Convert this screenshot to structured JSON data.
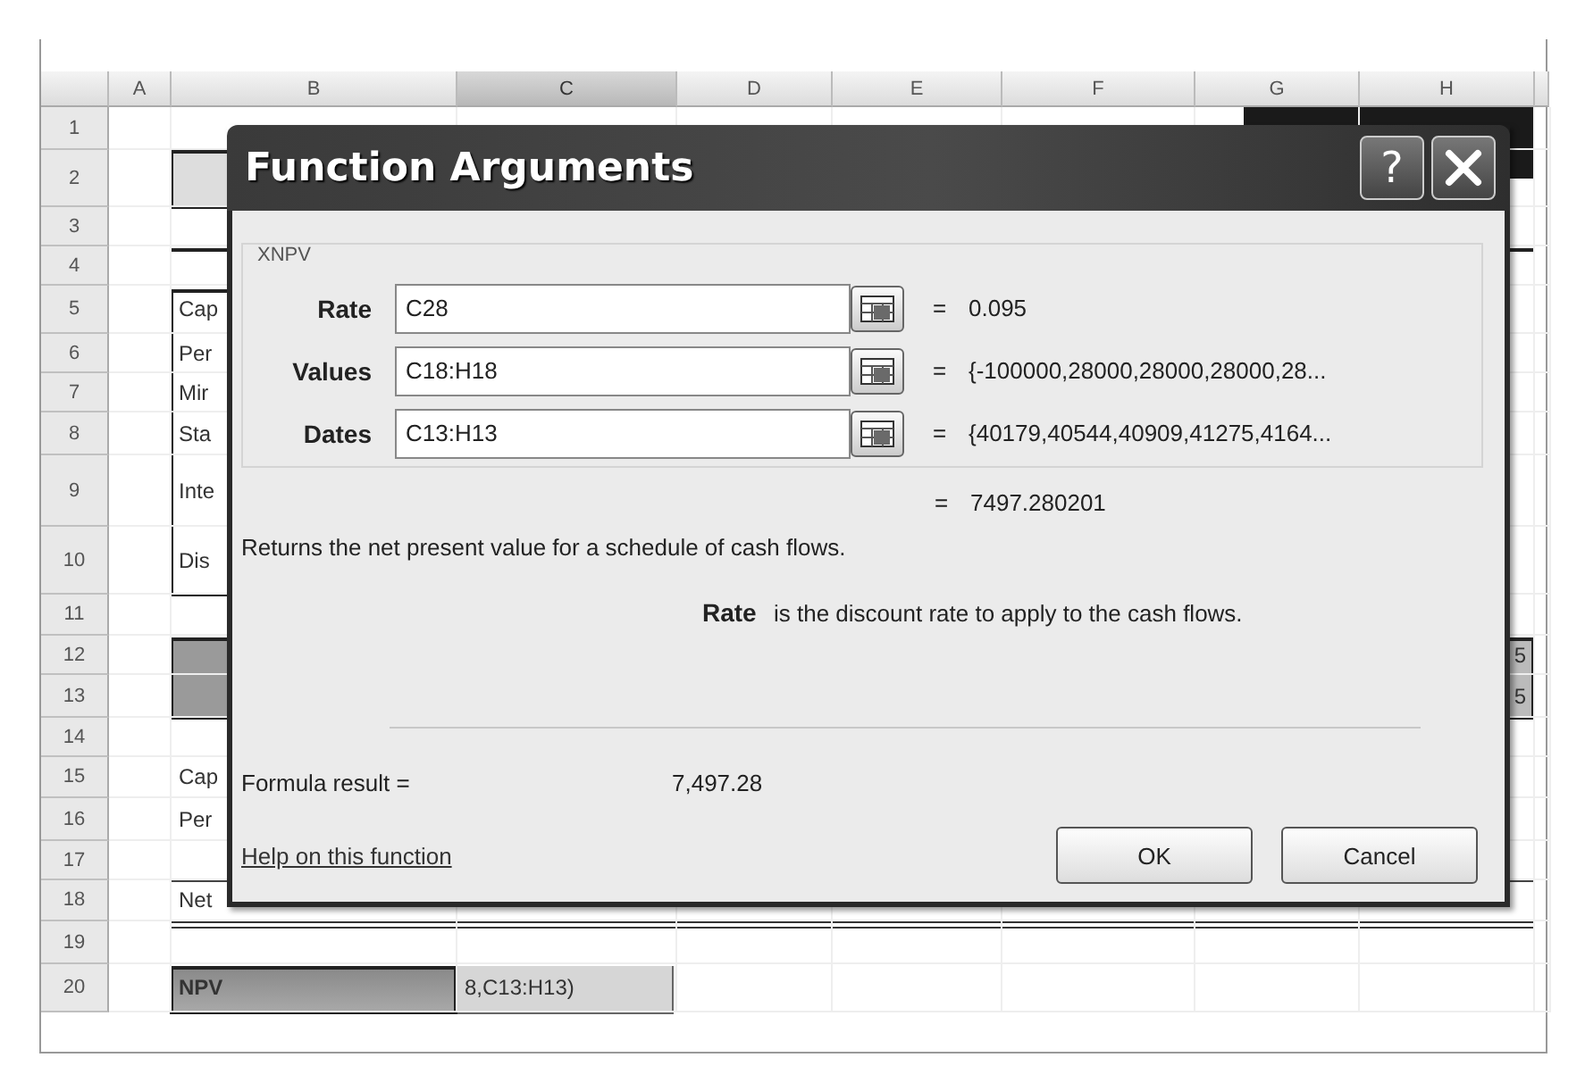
{
  "sheet": {
    "columns": [
      {
        "label": "A",
        "selected": false
      },
      {
        "label": "B",
        "selected": false
      },
      {
        "label": "C",
        "selected": true
      },
      {
        "label": "D",
        "selected": false
      },
      {
        "label": "E",
        "selected": false
      },
      {
        "label": "F",
        "selected": false
      },
      {
        "label": "G",
        "selected": false
      },
      {
        "label": "H",
        "selected": false
      }
    ],
    "rows": [
      {
        "number": "1",
        "cells": {}
      },
      {
        "number": "2",
        "cells": {}
      },
      {
        "number": "3",
        "cells": {}
      },
      {
        "number": "4",
        "cells": {}
      },
      {
        "number": "5",
        "cells": {
          "B": "Cap"
        }
      },
      {
        "number": "6",
        "cells": {
          "B": "Per"
        }
      },
      {
        "number": "7",
        "cells": {
          "B": "Mir"
        }
      },
      {
        "number": "8",
        "cells": {
          "B": "Sta"
        }
      },
      {
        "number": "9",
        "cells": {
          "B": "Inte"
        }
      },
      {
        "number": "10",
        "cells": {
          "B": "Dis"
        }
      },
      {
        "number": "11",
        "cells": {}
      },
      {
        "number": "12",
        "cells": {
          "H": "5"
        }
      },
      {
        "number": "13",
        "cells": {
          "H": "5"
        }
      },
      {
        "number": "14",
        "cells": {}
      },
      {
        "number": "15",
        "cells": {
          "B": "Cap"
        }
      },
      {
        "number": "16",
        "cells": {
          "B": "Per"
        }
      },
      {
        "number": "17",
        "cells": {}
      },
      {
        "number": "18",
        "cells": {
          "B": "Net"
        }
      },
      {
        "number": "19",
        "cells": {}
      },
      {
        "number": "20",
        "cells": {
          "B": "NPV",
          "C": "8,C13:H13)"
        }
      }
    ]
  },
  "dialog": {
    "title": "Function Arguments",
    "help_button": "?",
    "function_name": "XNPV",
    "arguments": [
      {
        "label": "Rate",
        "value": "C28",
        "equals": "=",
        "result": "0.095"
      },
      {
        "label": "Values",
        "value": "C18:H18",
        "equals": "=",
        "result": "{-100000,28000,28000,28000,28..."
      },
      {
        "label": "Dates",
        "value": "C13:H13",
        "equals": "=",
        "result": "{40179,40544,40909,41275,4164..."
      }
    ],
    "result": {
      "equals": "=",
      "value": "7497.280201"
    },
    "description": "Returns the net present value for a schedule of cash flows.",
    "argument_help": {
      "name": "Rate",
      "text": "is the discount rate to apply to the cash flows."
    },
    "formula_result_label": "Formula result =",
    "formula_result": "7,497.28",
    "help_link": "Help on this function",
    "buttons": [
      {
        "label": "OK"
      },
      {
        "label": "Cancel"
      }
    ]
  }
}
